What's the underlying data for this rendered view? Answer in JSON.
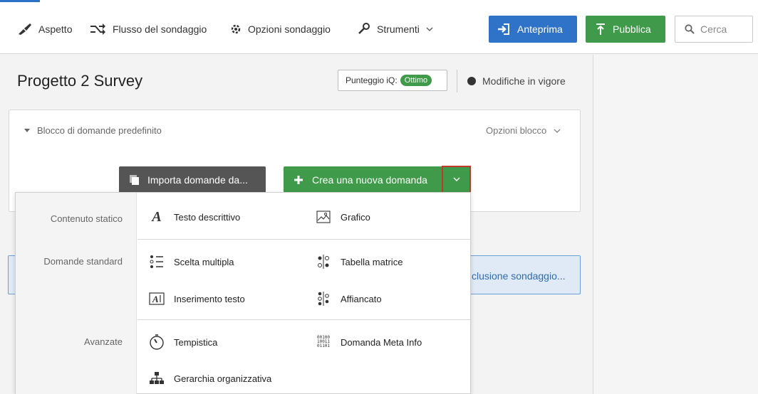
{
  "toolbar": {
    "aspect": "Aspetto",
    "flow": "Flusso del sondaggio",
    "options": "Opzioni sondaggio",
    "tools": "Strumenti",
    "preview": "Anteprima",
    "publish": "Pubblica",
    "search_placeholder": "Cerca"
  },
  "header": {
    "title": "Progetto 2 Survey",
    "score_label": "Punteggio iQ:",
    "score_value": "Ottimo",
    "changes": "Modifiche in vigore"
  },
  "block": {
    "title": "Blocco di domande predefinito",
    "options": "Opzioni blocco",
    "import_button": "Importa domande da...",
    "create_button": "Crea una nuova domanda"
  },
  "end_of_survey": "clusione sondaggio...",
  "menu": {
    "categories": {
      "static": "Contenuto statico",
      "standard": "Domande standard",
      "advanced": "Avanzate"
    },
    "items": {
      "descriptive_text": "Testo descrittivo",
      "graphic": "Grafico",
      "multiple_choice": "Scelta multipla",
      "matrix_table": "Tabella matrice",
      "text_entry": "Inserimento testo",
      "side_by_side": "Affiancato",
      "timing": "Tempistica",
      "meta_info": "Domanda Meta Info",
      "org_hierarchy": "Gerarchia organizzativa"
    }
  }
}
